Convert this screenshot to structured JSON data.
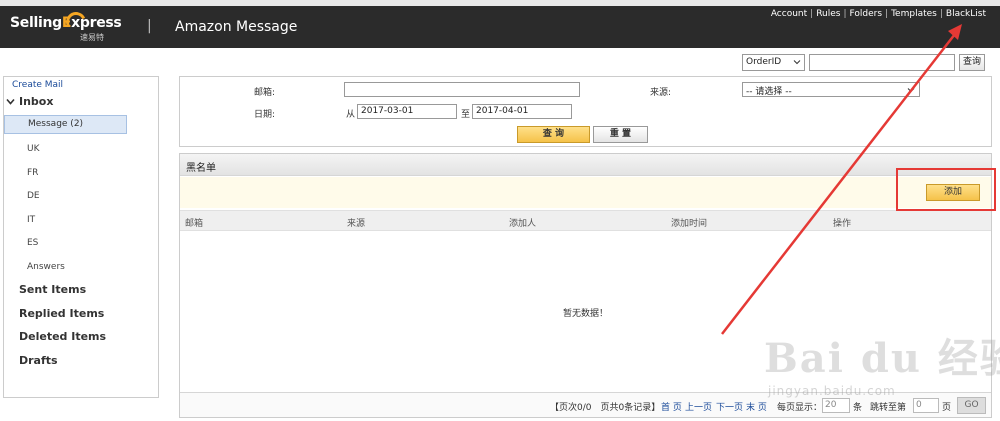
{
  "header": {
    "logo_word_a": "Selling",
    "logo_word_b": "xpress",
    "logo_x": "E",
    "logo_cn": "速易特",
    "separator": "|",
    "title": "Amazon Message",
    "nav": [
      "Account",
      "Rules",
      "Folders",
      "Templates",
      "BlackList"
    ]
  },
  "order_search": {
    "select_value": "OrderID",
    "button": "查询"
  },
  "sidebar": {
    "create_mail": "Create Mail",
    "inbox": "Inbox",
    "message": "Message (2)",
    "sub_items": [
      "UK",
      "FR",
      "DE",
      "IT",
      "ES",
      "Answers"
    ],
    "main_items": [
      "Sent Items",
      "Replied Items",
      "Deleted Items",
      "Drafts"
    ]
  },
  "filter": {
    "email_label": "邮箱:",
    "source_label": "来源:",
    "source_value": "-- 请选择 --",
    "date_label": "日期:",
    "from_label": "从",
    "from_value": "2017-03-01",
    "to_label": "至",
    "to_value": "2017-04-01",
    "query_button": "查 询",
    "reset_button": "重 置"
  },
  "blacklist": {
    "title": "黑名单",
    "add_button": "添加",
    "columns": [
      "邮箱",
      "来源",
      "添加人",
      "添加时间",
      "操作"
    ],
    "empty_text": "暂无数据！",
    "pager": {
      "page_info": "【页次0/0　页共0条记录】",
      "first": "首 页",
      "prev": "上一页",
      "next": "下一页",
      "last": "末 页",
      "per_page_label": "每页显示：",
      "per_page_value": "20",
      "unit_rows": "条",
      "jump_label": "跳转至第",
      "jump_value": "0",
      "unit_page": "页",
      "go": "GO"
    }
  },
  "annotation_color": "#e53935",
  "watermark": {
    "big": "Bai du 经验",
    "small": "jingyan.baidu.com"
  }
}
